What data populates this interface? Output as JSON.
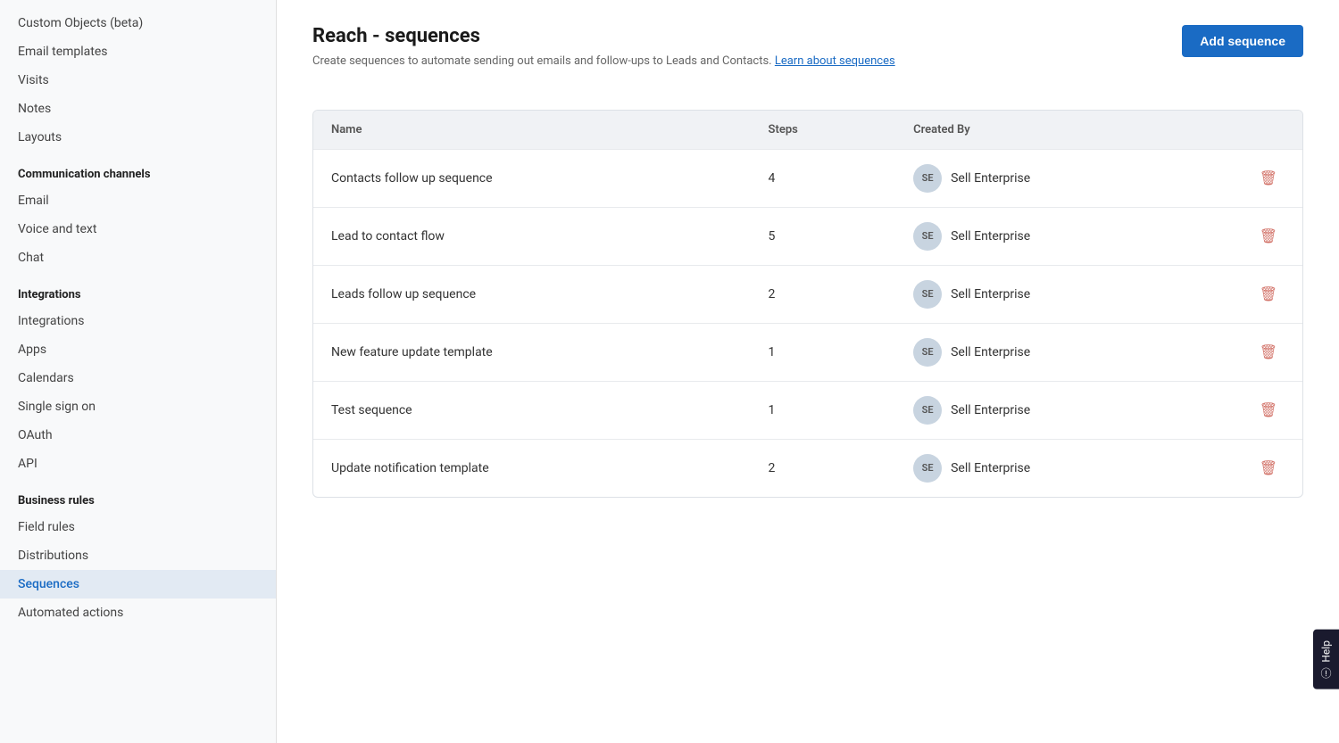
{
  "sidebar": {
    "sections": [
      {
        "items": [
          {
            "label": "Custom Objects (beta)",
            "active": false
          },
          {
            "label": "Email templates",
            "active": false
          },
          {
            "label": "Visits",
            "active": false
          },
          {
            "label": "Notes",
            "active": false
          },
          {
            "label": "Layouts",
            "active": false
          }
        ]
      },
      {
        "header": "Communication channels",
        "items": [
          {
            "label": "Email",
            "active": false
          },
          {
            "label": "Voice and text",
            "active": false
          },
          {
            "label": "Chat",
            "active": false
          }
        ]
      },
      {
        "header": "Integrations",
        "items": [
          {
            "label": "Integrations",
            "active": false
          },
          {
            "label": "Apps",
            "active": false
          },
          {
            "label": "Calendars",
            "active": false
          },
          {
            "label": "Single sign on",
            "active": false
          },
          {
            "label": "OAuth",
            "active": false
          },
          {
            "label": "API",
            "active": false
          }
        ]
      },
      {
        "header": "Business rules",
        "items": [
          {
            "label": "Field rules",
            "active": false
          },
          {
            "label": "Distributions",
            "active": false
          },
          {
            "label": "Sequences",
            "active": true
          },
          {
            "label": "Automated actions",
            "active": false
          }
        ]
      }
    ]
  },
  "page": {
    "title": "Reach - sequences",
    "subtitle": "Create sequences to automate sending out emails and follow-ups to Leads and Contacts.",
    "learn_link": "Learn about sequences",
    "add_button": "Add sequence"
  },
  "table": {
    "columns": [
      {
        "key": "name",
        "label": "Name"
      },
      {
        "key": "steps",
        "label": "Steps"
      },
      {
        "key": "created_by",
        "label": "Created By"
      },
      {
        "key": "action",
        "label": ""
      }
    ],
    "rows": [
      {
        "name": "Contacts follow up sequence",
        "steps": "4",
        "created_by": "Sell Enterprise",
        "avatar": "SE"
      },
      {
        "name": "Lead to contact flow",
        "steps": "5",
        "created_by": "Sell Enterprise",
        "avatar": "SE"
      },
      {
        "name": "Leads follow up sequence",
        "steps": "2",
        "created_by": "Sell Enterprise",
        "avatar": "SE"
      },
      {
        "name": "New feature update template",
        "steps": "1",
        "created_by": "Sell Enterprise",
        "avatar": "SE"
      },
      {
        "name": "Test sequence",
        "steps": "1",
        "created_by": "Sell Enterprise",
        "avatar": "SE"
      },
      {
        "name": "Update notification template",
        "steps": "2",
        "created_by": "Sell Enterprise",
        "avatar": "SE"
      }
    ]
  },
  "help": {
    "label": "Help"
  }
}
